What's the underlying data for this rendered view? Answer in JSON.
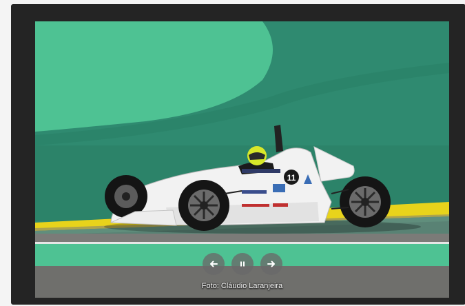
{
  "slideshow": {
    "photo_alt": "Race car",
    "car_number": "11",
    "caption": "Foto: Cláudio Laranjeira",
    "controls": {
      "previous_icon": "arrow-left-icon",
      "pause_icon": "pause-icon",
      "next_icon": "arrow-right-icon"
    }
  },
  "colors": {
    "frame": "#242424",
    "grass_bright": "#4ec293",
    "grass_dark": "#2f8a70",
    "curb_yellow": "#e8d31b",
    "asphalt": "#7b7b78",
    "car_body": "#f2f2f2",
    "helmet": "#d8e82a"
  }
}
